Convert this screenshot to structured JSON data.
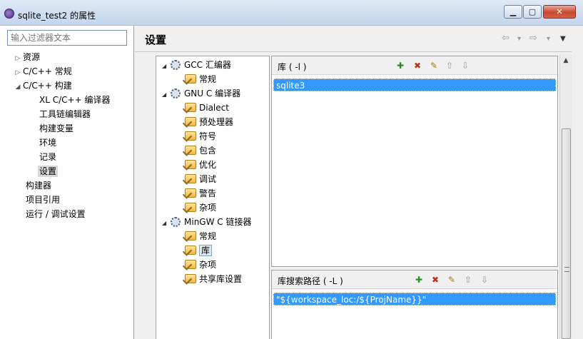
{
  "window": {
    "title": "sqlite_test2 的属性",
    "min_glyph": "▁",
    "max_glyph": "▢",
    "close_glyph": "✕"
  },
  "sidebar": {
    "filter_placeholder": "输入过滤器文本",
    "items": [
      {
        "label": "资源",
        "expander": "▷"
      },
      {
        "label": "C/C++ 常规",
        "expander": "▷"
      },
      {
        "label": "C/C++ 构建",
        "expander": "◢"
      },
      {
        "label": "XL C/C++ 编译器"
      },
      {
        "label": "工具链编辑器"
      },
      {
        "label": "构建变量"
      },
      {
        "label": "环境"
      },
      {
        "label": "记录"
      },
      {
        "label": "设置",
        "selected": true
      },
      {
        "label": "构建器"
      },
      {
        "label": "项目引用"
      },
      {
        "label": "运行 / 调试设置"
      }
    ]
  },
  "header": {
    "title": "设置",
    "back_icon": "⇦",
    "back_menu_icon": "▾",
    "forward_icon": "⇨",
    "forward_menu_icon": "▾",
    "view_menu_icon": "▼"
  },
  "tool_tree": {
    "expanded_glyph": "◢",
    "items": [
      {
        "label": "GCC 汇编器",
        "type": "tool"
      },
      {
        "label": "常规",
        "type": "option"
      },
      {
        "label": "GNU C 编译器",
        "type": "tool"
      },
      {
        "label": "Dialect",
        "type": "option"
      },
      {
        "label": "预处理器",
        "type": "option"
      },
      {
        "label": "符号",
        "type": "option"
      },
      {
        "label": "包含",
        "type": "option"
      },
      {
        "label": "优化",
        "type": "option"
      },
      {
        "label": "调试",
        "type": "option"
      },
      {
        "label": "警告",
        "type": "option"
      },
      {
        "label": "杂项",
        "type": "option"
      },
      {
        "label": "MinGW C 链接器",
        "type": "tool"
      },
      {
        "label": "常规",
        "type": "option"
      },
      {
        "label": "库",
        "type": "option",
        "selected": true
      },
      {
        "label": "杂项",
        "type": "option"
      },
      {
        "label": "共享库设置",
        "type": "option"
      }
    ]
  },
  "libraries_panel": {
    "label": "库 ( -l )",
    "items": [
      "sqlite3"
    ]
  },
  "library_paths_panel": {
    "label": "库搜索路径 ( -L )",
    "items": [
      "\"${workspace_loc:/${ProjName}}\""
    ]
  },
  "toolbar_icons": {
    "add": "✚",
    "delete": "✖",
    "edit": "✎",
    "move_up": "⇧",
    "move_down": "⇩"
  },
  "scrollbar": {
    "up_glyph": "▲"
  }
}
